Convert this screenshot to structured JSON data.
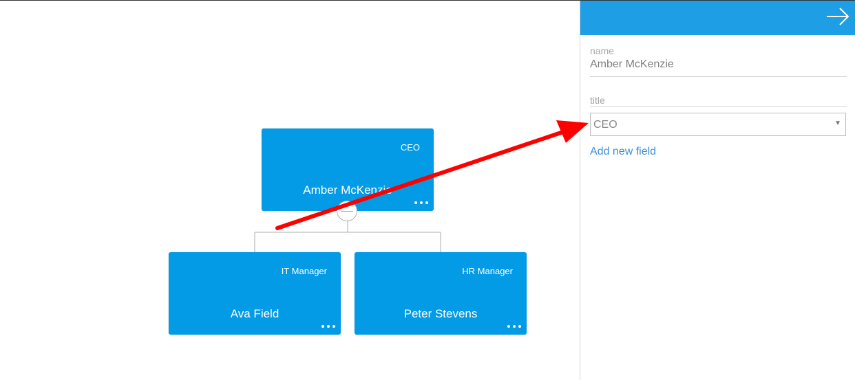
{
  "chart_nodes": [
    {
      "title": "CEO",
      "name": "Amber McKenzie"
    },
    {
      "title": "IT Manager",
      "name": "Ava Field"
    },
    {
      "title": "HR Manager",
      "name": "Peter Stevens"
    }
  ],
  "sidebar": {
    "name_label": "name",
    "name_value": "Amber McKenzie",
    "title_label": "title",
    "title_select_value": "CEO",
    "add_field_label": "Add new field"
  },
  "icons": {
    "close": "arrow-right-icon",
    "more": "more-dots-icon",
    "collapse": "minus-icon",
    "caret": "caret-down-icon"
  },
  "colors": {
    "node": "#039be5",
    "header": "#1e9ee5",
    "link": "#3c8fd9",
    "annotation": "#ff0000"
  }
}
